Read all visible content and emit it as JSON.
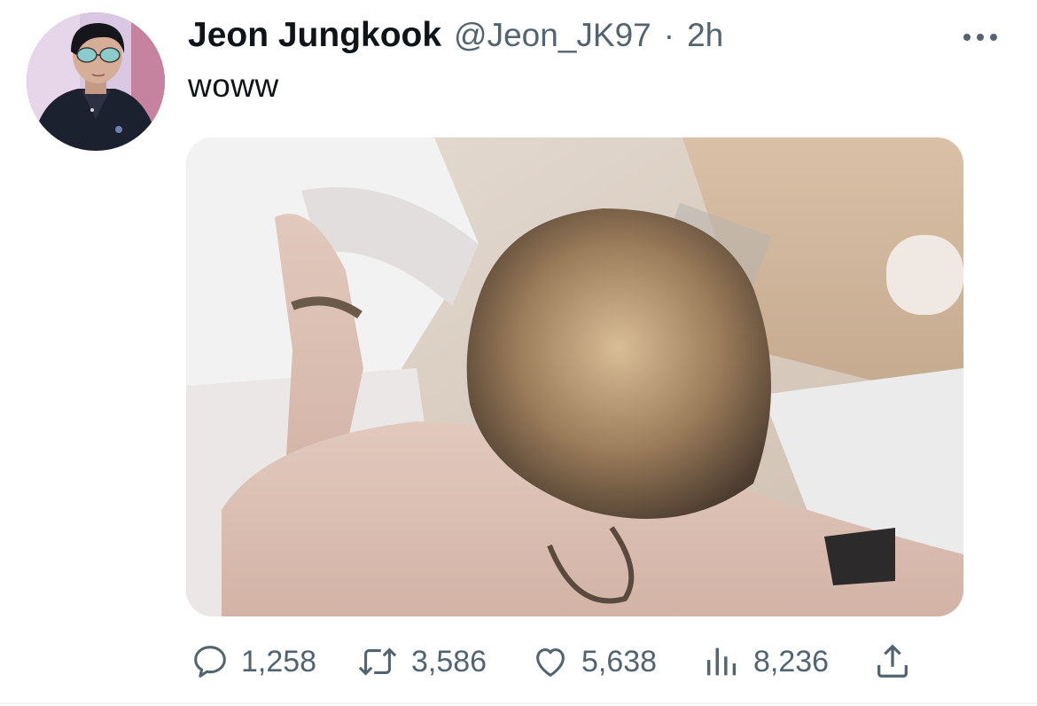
{
  "tweet": {
    "author": {
      "display_name": "Jeon Jungkook",
      "handle": "@Jeon_JK97",
      "separator": "·",
      "time": "2h"
    },
    "text": "woww",
    "media": {
      "type": "image"
    },
    "actions": {
      "replies": "1,258",
      "retweets": "3,586",
      "likes": "5,638",
      "views": "8,236"
    },
    "icons": {
      "more": "more-horizontal-icon",
      "reply": "reply-bubble-icon",
      "retweet": "retweet-icon",
      "like": "heart-icon",
      "views": "bar-chart-icon",
      "share": "share-upload-icon"
    },
    "colors": {
      "text": "#0f1419",
      "secondary": "#536471"
    }
  }
}
